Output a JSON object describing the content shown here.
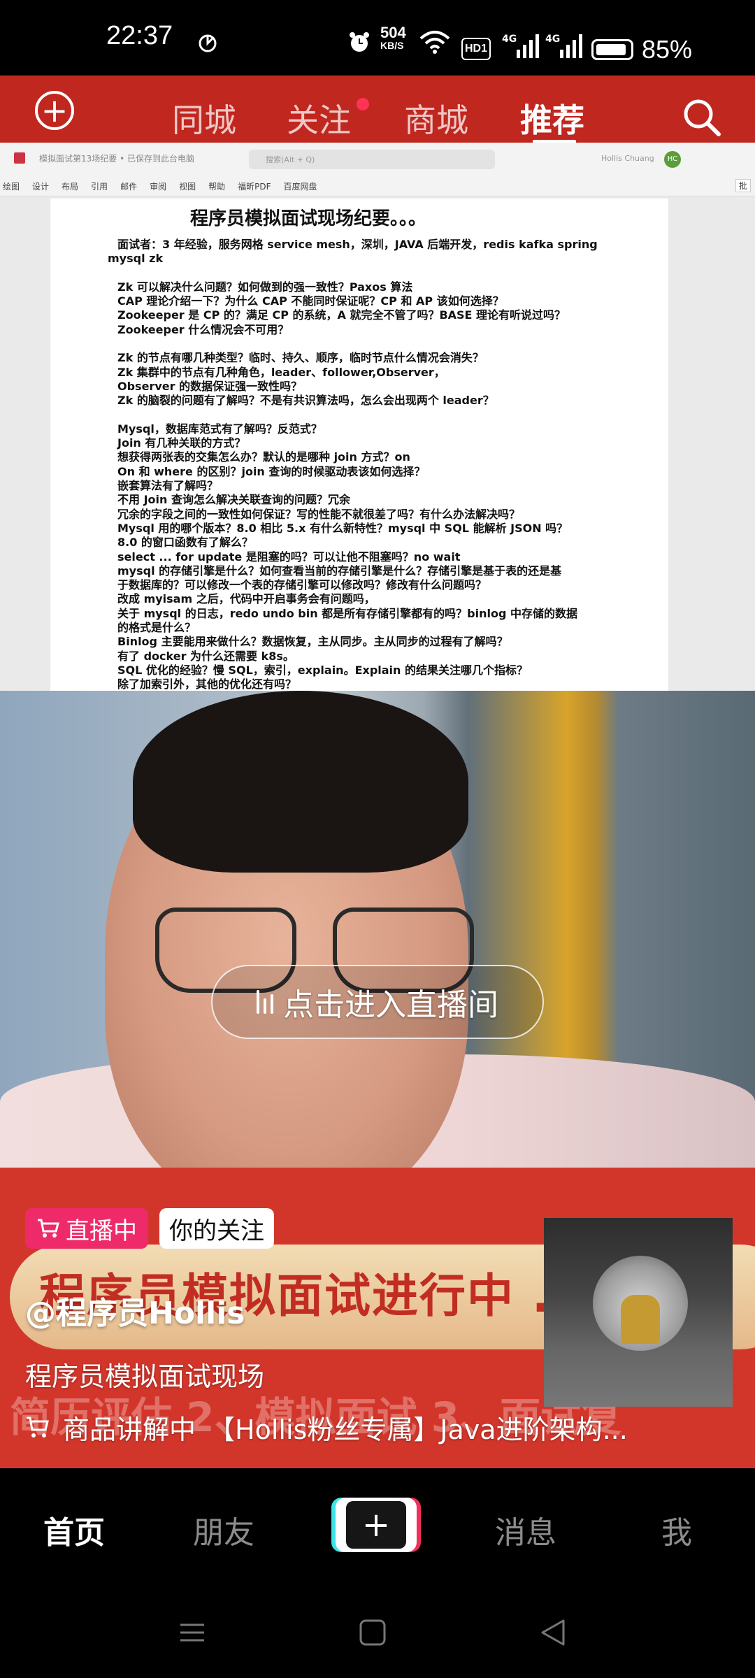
{
  "status_bar": {
    "time": "22:37",
    "net_speed_top": "504",
    "net_speed_unit": "KB/S",
    "signal_1": "4G",
    "signal_2": "4G",
    "hd_label": "HD1",
    "battery_percent": "85%",
    "battery_level": 0.85
  },
  "top_nav": {
    "tabs": [
      "同城",
      "关注",
      "商城",
      "推荐"
    ],
    "active_tab": "推荐"
  },
  "document": {
    "title_bar": "模拟面试第13场纪要 • 已保存到此台电脑",
    "search_placeholder": "搜索(Alt + Q)",
    "user_name": "Hollis Chuang",
    "user_initials": "HC",
    "menu_items": [
      "绘图",
      "设计",
      "布局",
      "引用",
      "邮件",
      "审阅",
      "视图",
      "帮助",
      "福昕PDF",
      "百度网盘"
    ],
    "batch_label": "批",
    "heading": "程序员模拟面试现场纪要。。。",
    "lines": [
      "面试者：3 年经验，服务网格 service mesh，深圳，JAVA 后端开发，redis kafka spring",
      "mysql zk",
      "",
      "Zk 可以解决什么问题？如何做到的强一致性？Paxos 算法",
      "CAP 理论介绍一下？为什么 CAP 不能同时保证呢？CP 和 AP 该如何选择？",
      "Zookeeper 是 CP 的？满足 CP 的系统，A 就完全不管了吗？BASE 理论有听说过吗？",
      "Zookeeper 什么情况会不可用？",
      "",
      "Zk 的节点有哪几种类型？临时、持久、顺序，临时节点什么情况会消失？",
      "Zk 集群中的节点有几种角色，leader、follower,Observer，",
      "Observer 的数据保证强一致性吗？",
      "Zk 的脑裂的问题有了解吗？不是有共识算法吗，怎么会出现两个 leader？",
      "",
      "Mysql，数据库范式有了解吗？反范式？",
      "Join 有几种关联的方式？",
      "想获得两张表的交集怎么办？默认的是哪种 join 方式？on",
      "On 和 where 的区别？join 查询的时候驱动表该如何选择？",
      "嵌套算法有了解吗？",
      "不用 Join 查询怎么解决关联查询的问题？冗余",
      "冗余的字段之间的一致性如何保证？写的性能不就很差了吗？有什么办法解决吗？",
      "Mysql 用的哪个版本？8.0 相比 5.x 有什么新特性？mysql 中 SQL 能解析 JSON 吗？",
      "8.0 的窗口函数有了解么？",
      "select ... for update 是阻塞的吗？可以让他不阻塞吗？no wait",
      "mysql 的存储引擎是什么？如何查看当前的存储引擎是什么？存储引擎是基于表的还是基",
      "于数据库的？可以修改一个表的存储引擎可以修改吗？修改有什么问题吗？",
      "改成 myisam 之后，代码中开启事务会有问题吗，",
      "关于 mysql 的日志，redo undo bin 都是所有存储引擎都有的吗？binlog 中存储的数据",
      "的格式是什么？",
      "Binlog 主要能用来做什么？数据恢复，主从同步。主从同步的过程有了解吗？",
      "有了 docker 为什么还需要 k8s。",
      "SQL 优化的经验？慢 SQL，索引，explain。Explain 的结果关注哪几个指标？",
      "除了加索引外，其他的优化还有吗？"
    ]
  },
  "live": {
    "enter_label": "点击进入直播间",
    "badge_live": "直播中",
    "badge_follow": "你的关注",
    "banner_text": "程序员模拟面试进行中 .",
    "banner_sub": "简历评估 2、模拟面试 3、面试复",
    "author": "@程序员Hollis",
    "description": "程序员模拟面试现场",
    "product_status": "商品讲解中",
    "product_title": "【Hollis粉丝专属】Java进阶架构..."
  },
  "tab_bar": {
    "home": "首页",
    "friends": "朋友",
    "create": "+",
    "messages": "消息",
    "me": "我",
    "active": "首页"
  },
  "colors": {
    "top_nav_bg": "#c0271f",
    "live_badge": "#ee2a6a",
    "banner_bg": "#d2362b",
    "unread_dot": "#ff3355"
  }
}
